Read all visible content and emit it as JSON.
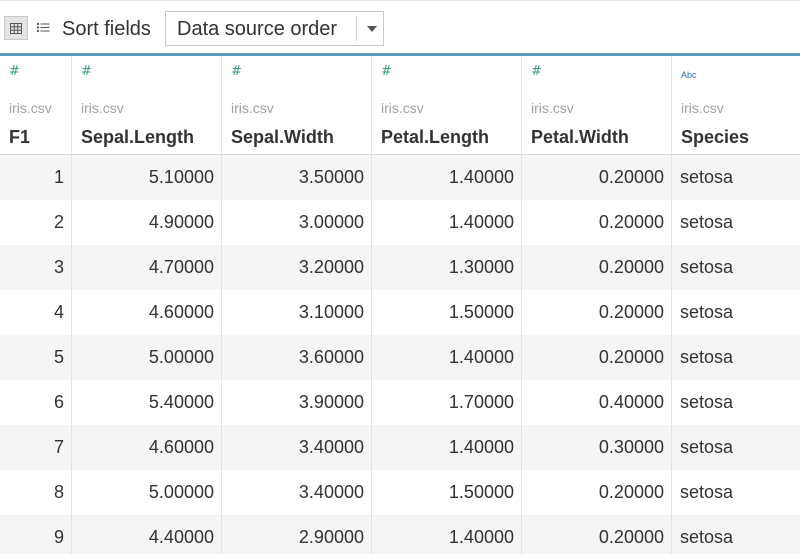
{
  "toolbar": {
    "grid_view_icon": "grid-view-icon",
    "list_view_icon": "list-view-icon",
    "sort_label": "Sort fields",
    "sort_value": "Data source order"
  },
  "columns": [
    {
      "type_icon": "#",
      "type": "number",
      "source": "iris.csv",
      "name": "F1"
    },
    {
      "type_icon": "#",
      "type": "number",
      "source": "iris.csv",
      "name": "Sepal.Length"
    },
    {
      "type_icon": "#",
      "type": "number",
      "source": "iris.csv",
      "name": "Sepal.Width"
    },
    {
      "type_icon": "#",
      "type": "number",
      "source": "iris.csv",
      "name": "Petal.Length"
    },
    {
      "type_icon": "#",
      "type": "number",
      "source": "iris.csv",
      "name": "Petal.Width"
    },
    {
      "type_icon": "Abc",
      "type": "string",
      "source": "iris.csv",
      "name": "Species"
    }
  ],
  "rows": [
    [
      "1",
      "5.10000",
      "3.50000",
      "1.40000",
      "0.20000",
      "setosa"
    ],
    [
      "2",
      "4.90000",
      "3.00000",
      "1.40000",
      "0.20000",
      "setosa"
    ],
    [
      "3",
      "4.70000",
      "3.20000",
      "1.30000",
      "0.20000",
      "setosa"
    ],
    [
      "4",
      "4.60000",
      "3.10000",
      "1.50000",
      "0.20000",
      "setosa"
    ],
    [
      "5",
      "5.00000",
      "3.60000",
      "1.40000",
      "0.20000",
      "setosa"
    ],
    [
      "6",
      "5.40000",
      "3.90000",
      "1.70000",
      "0.40000",
      "setosa"
    ],
    [
      "7",
      "4.60000",
      "3.40000",
      "1.40000",
      "0.30000",
      "setosa"
    ],
    [
      "8",
      "5.00000",
      "3.40000",
      "1.50000",
      "0.20000",
      "setosa"
    ],
    [
      "9",
      "4.40000",
      "2.90000",
      "1.40000",
      "0.20000",
      "setosa"
    ]
  ],
  "colors": {
    "accent": "#5b9bbd",
    "number_icon": "#3a9a85",
    "string_icon": "#2f6fa8",
    "row_shade": "#f5f5f5"
  }
}
